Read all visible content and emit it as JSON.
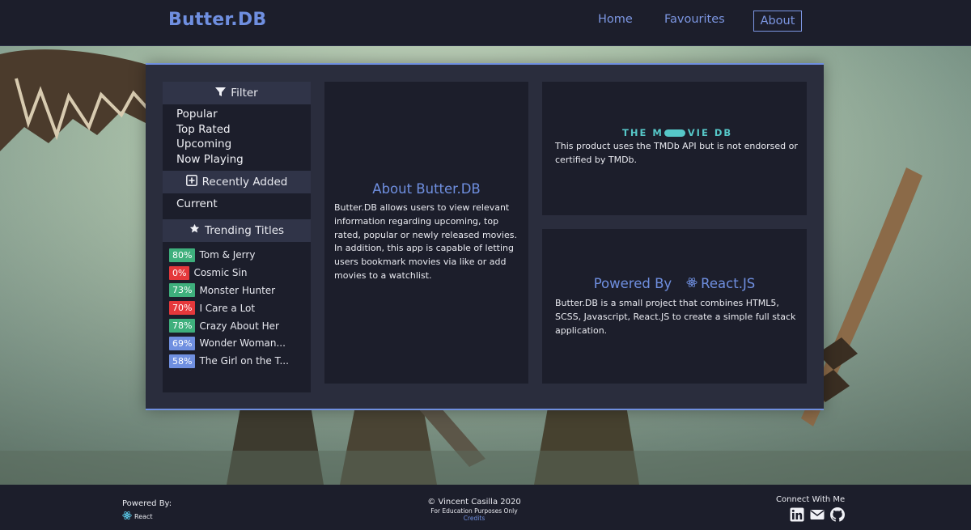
{
  "nav": {
    "brand": "Butter.DB",
    "links": [
      {
        "label": "Home"
      },
      {
        "label": "Favourites"
      },
      {
        "label": "About"
      }
    ]
  },
  "sidebar": {
    "filter": {
      "title": "Filter",
      "icon": "filter-icon",
      "items": [
        "Popular",
        "Top Rated",
        "Upcoming",
        "Now Playing"
      ]
    },
    "recent": {
      "title": "Recently Added",
      "icon": "plus-square-icon",
      "items": [
        "Current"
      ]
    },
    "trending": {
      "title": "Trending Titles",
      "icon": "star-icon",
      "items": [
        {
          "score": "80%",
          "title": "Tom & Jerry",
          "color": "#3eaf7c"
        },
        {
          "score": "0%",
          "title": "Cosmic Sin",
          "color": "#e5383b"
        },
        {
          "score": "73%",
          "title": "Monster Hunter",
          "color": "#3eaf7c"
        },
        {
          "score": "70%",
          "title": "I Care a Lot",
          "color": "#e5383b"
        },
        {
          "score": "78%",
          "title": "Crazy About Her",
          "color": "#3eaf7c"
        },
        {
          "score": "69%",
          "title": "Wonder Woman...",
          "color": "#6f8fe0"
        },
        {
          "score": "58%",
          "title": "The Girl on the T...",
          "color": "#6f8fe0"
        }
      ]
    }
  },
  "about": {
    "title": "About Butter.DB",
    "body": "Butter.DB allows users to view relevant information regarding upcoming, top rated, popular or newly released movies. In addition, this app is capable of letting users bookmark movies via like or add movies to a watchlist."
  },
  "tmdb": {
    "logo_left": "THE M",
    "logo_right": "VIE DB",
    "body": "This product uses the TMDb API but is not endorsed or certified by TMDb."
  },
  "powered": {
    "title": "Powered By",
    "tech": "React.JS",
    "body": "Butter.DB is a small project that combines HTML5, SCSS, Javascript, React.JS to create a simple full stack application."
  },
  "footer": {
    "powered_label": "Powered By:",
    "react_label": "React",
    "copyright": "© Vincent Casilla 2020",
    "education": "For Education Purposes Only",
    "credits": "Credits",
    "connect": "Connect With Me",
    "social_icons": [
      "linkedin-icon",
      "email-icon",
      "github-icon"
    ]
  },
  "colors": {
    "accent": "#6f8fe0",
    "background": "#1c1e2b",
    "panel": "#2a2d3d",
    "tmdb": "#56c7c8"
  }
}
